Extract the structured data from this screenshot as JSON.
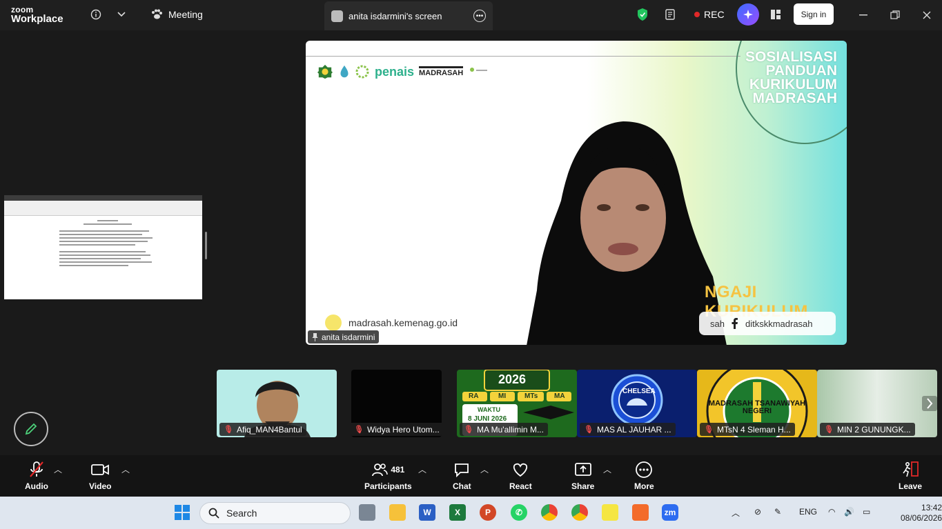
{
  "app": {
    "brand_line1": "zoom",
    "brand_line2": "Workplace"
  },
  "topbar": {
    "meeting_label": "Meeting",
    "share_tab": "anita isdarmini's screen",
    "rec_label": "REC",
    "signin_label": "Sign in"
  },
  "shared_screen": {
    "title": "SOSIALISASI PANDUAN KURIKULUM MADRASAH",
    "logo_penais": "penais",
    "logo_madrasah": "MADRASAH",
    "banner": "NGAJI KURIKULUM",
    "url": "madrasah.kemenag.go.id",
    "social_partial": "sah",
    "social_handle": "ditkskkmadrasah",
    "presenter_name": "anita isdarmini"
  },
  "participants_strip": [
    {
      "name": "Afiq_MAN4Bantul",
      "bg": "#b7ece8"
    },
    {
      "name": "Widya Hero Utom...",
      "bg": "#050505"
    },
    {
      "name": "MA Mu'allimin M...",
      "bg": "#1e6a1e",
      "poster_text": "2026",
      "chips": [
        "RA",
        "MI",
        "MTs",
        "MA"
      ],
      "date": "8 JUNI 2026",
      "waktu": "WAKTU"
    },
    {
      "name": "MAS AL JAUHAR ...",
      "bg": "#0b2a8a",
      "badge": "CHELSEA"
    },
    {
      "name": "MTsN 4 Sleman H...",
      "bg": "#e6b81a",
      "ring": "MADRASAH TSANAWIYAH NEGERI"
    },
    {
      "name": "MIN 2 GUNUNGK...",
      "bg": "#cfe0cf"
    }
  ],
  "controls": {
    "audio": "Audio",
    "video": "Video",
    "participants": "Participants",
    "participants_count": "481",
    "chat": "Chat",
    "react": "React",
    "share": "Share",
    "more": "More",
    "leave": "Leave"
  },
  "taskbar": {
    "search": "Search",
    "lang": "ENG",
    "time": "13:42",
    "date": "08/06/2026"
  }
}
